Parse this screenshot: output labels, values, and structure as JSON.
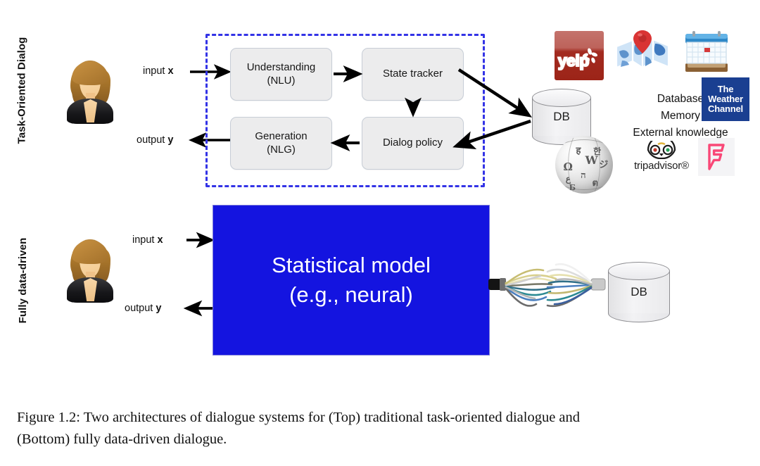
{
  "figure": {
    "caption_line1": "Figure 1.2:  Two architectures of dialogue systems for (Top) traditional task-oriented dialogue and",
    "caption_line2": "(Bottom) fully data-driven dialogue."
  },
  "top_panel": {
    "row_label": "Task-Oriented Dialog",
    "input_label_prefix": "input ",
    "input_label_var": "x",
    "output_label_prefix": "output ",
    "output_label_var": "y",
    "boxes": [
      {
        "id": "nlu",
        "line1": "Understanding",
        "line2": "(NLU)"
      },
      {
        "id": "state-tracker",
        "line1": "State tracker",
        "line2": ""
      },
      {
        "id": "nlg",
        "line1": "Generation",
        "line2": "(NLG)"
      },
      {
        "id": "dialog-policy",
        "line1": "Dialog policy",
        "line2": ""
      }
    ],
    "db_label": "DB",
    "knowledge_sources": [
      "Database",
      "Memory",
      "External knowledge"
    ],
    "logos": [
      {
        "id": "yelp",
        "name": "yelp-logo",
        "text": "yelp"
      },
      {
        "id": "maps",
        "name": "map-logo",
        "text": ""
      },
      {
        "id": "calendar",
        "name": "calendar-logo",
        "text": ""
      },
      {
        "id": "weather-channel",
        "name": "weather-channel-logo",
        "line1": "The",
        "line2": "Weather",
        "line3": "Channel"
      },
      {
        "id": "wikipedia",
        "name": "wikipedia-globe-logo",
        "text": ""
      },
      {
        "id": "tripadvisor",
        "name": "tripadvisor-logo",
        "text": "tripadvisor®"
      },
      {
        "id": "foursquare",
        "name": "foursquare-logo",
        "text": ""
      }
    ]
  },
  "bottom_panel": {
    "row_label": "Fully data-driven",
    "input_label_prefix": "input ",
    "input_label_var": "x",
    "output_label_prefix": "output ",
    "output_label_var": "y",
    "model_line1": "Statistical model",
    "model_line2": "(e.g., neural)",
    "db_label": "DB"
  },
  "colors": {
    "dashed_border": "#3333e6",
    "model_box": "#1414e0",
    "process_box": "#ececed",
    "yelp_red": "#9c2418",
    "weather_blue": "#1a3f91",
    "foursquare_pink": "#f94877",
    "page_background": "#ffffff"
  }
}
